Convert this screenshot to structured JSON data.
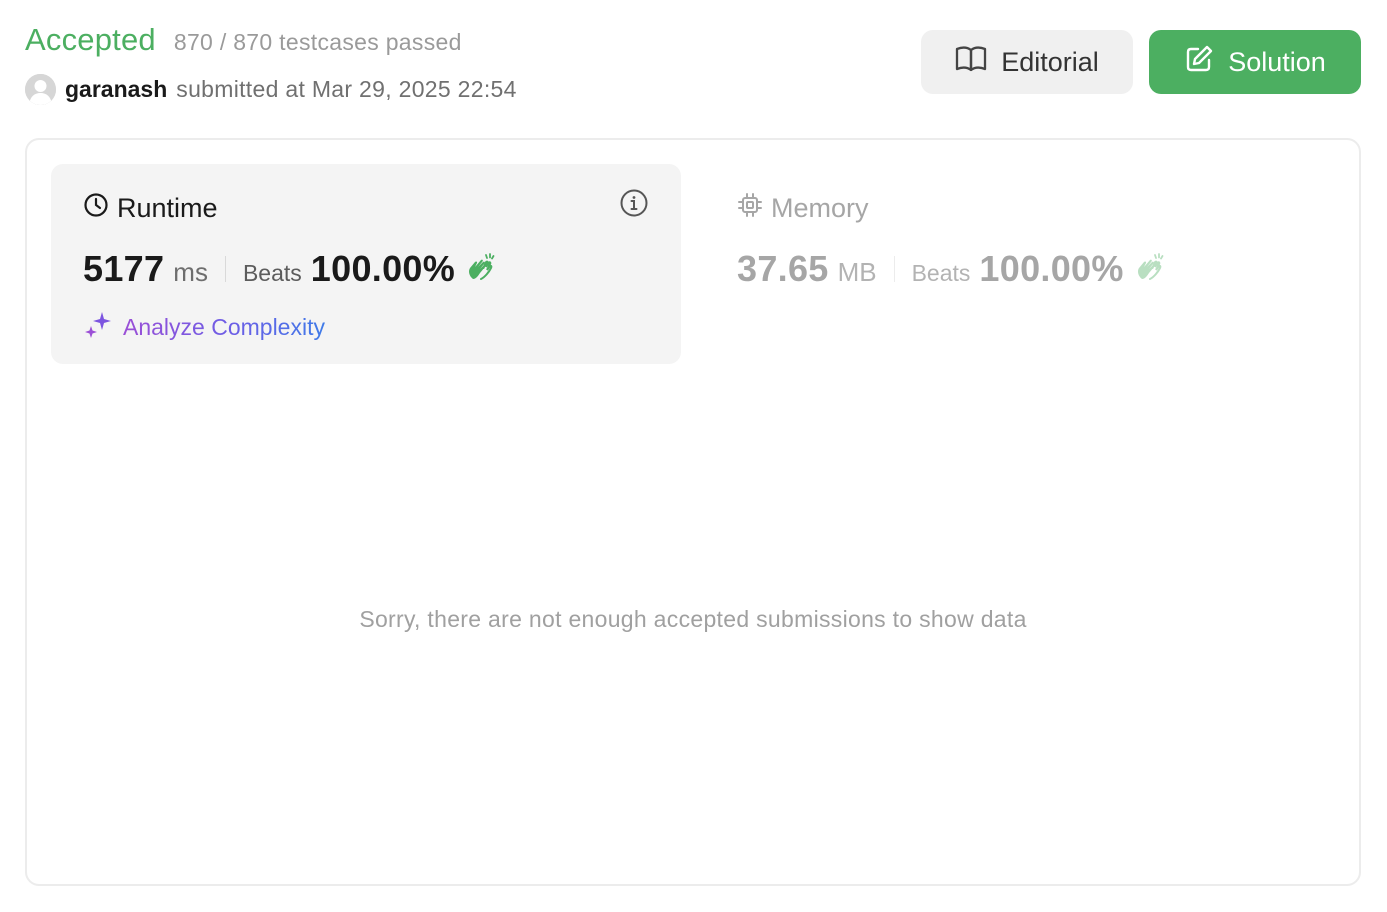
{
  "submission": {
    "status": "Accepted",
    "testcases": "870 / 870 testcases passed",
    "username": "garanash",
    "submitted_at": "submitted at Mar 29, 2025 22:54"
  },
  "buttons": {
    "editorial_label": "Editorial",
    "solution_label": "Solution"
  },
  "runtime": {
    "title": "Runtime",
    "value": "5177",
    "unit": "ms",
    "beats_label": "Beats",
    "beats_value": "100.00%",
    "analyze_label": "Analyze Complexity"
  },
  "memory": {
    "title": "Memory",
    "value": "37.65",
    "unit": "MB",
    "beats_label": "Beats",
    "beats_value": "100.00%"
  },
  "empty_message": "Sorry, there are not enough accepted submissions to show data",
  "icons": {
    "avatar": "user-avatar-icon",
    "editorial": "book-open-icon",
    "solution": "edit-pencil-icon",
    "runtime": "clock-icon",
    "info": "info-circle-icon",
    "memory": "chip-icon",
    "beats": "clap-hands-icon",
    "analyze": "sparkle-icon"
  },
  "colors": {
    "accepted": "#4caf61",
    "solution_button": "#4caf61",
    "editorial_button": "#f0f0f0",
    "runtime_box": "#f4f4f4",
    "analyze_gradient_start": "#9b4fd6",
    "analyze_gradient_end": "#3f7be8"
  }
}
